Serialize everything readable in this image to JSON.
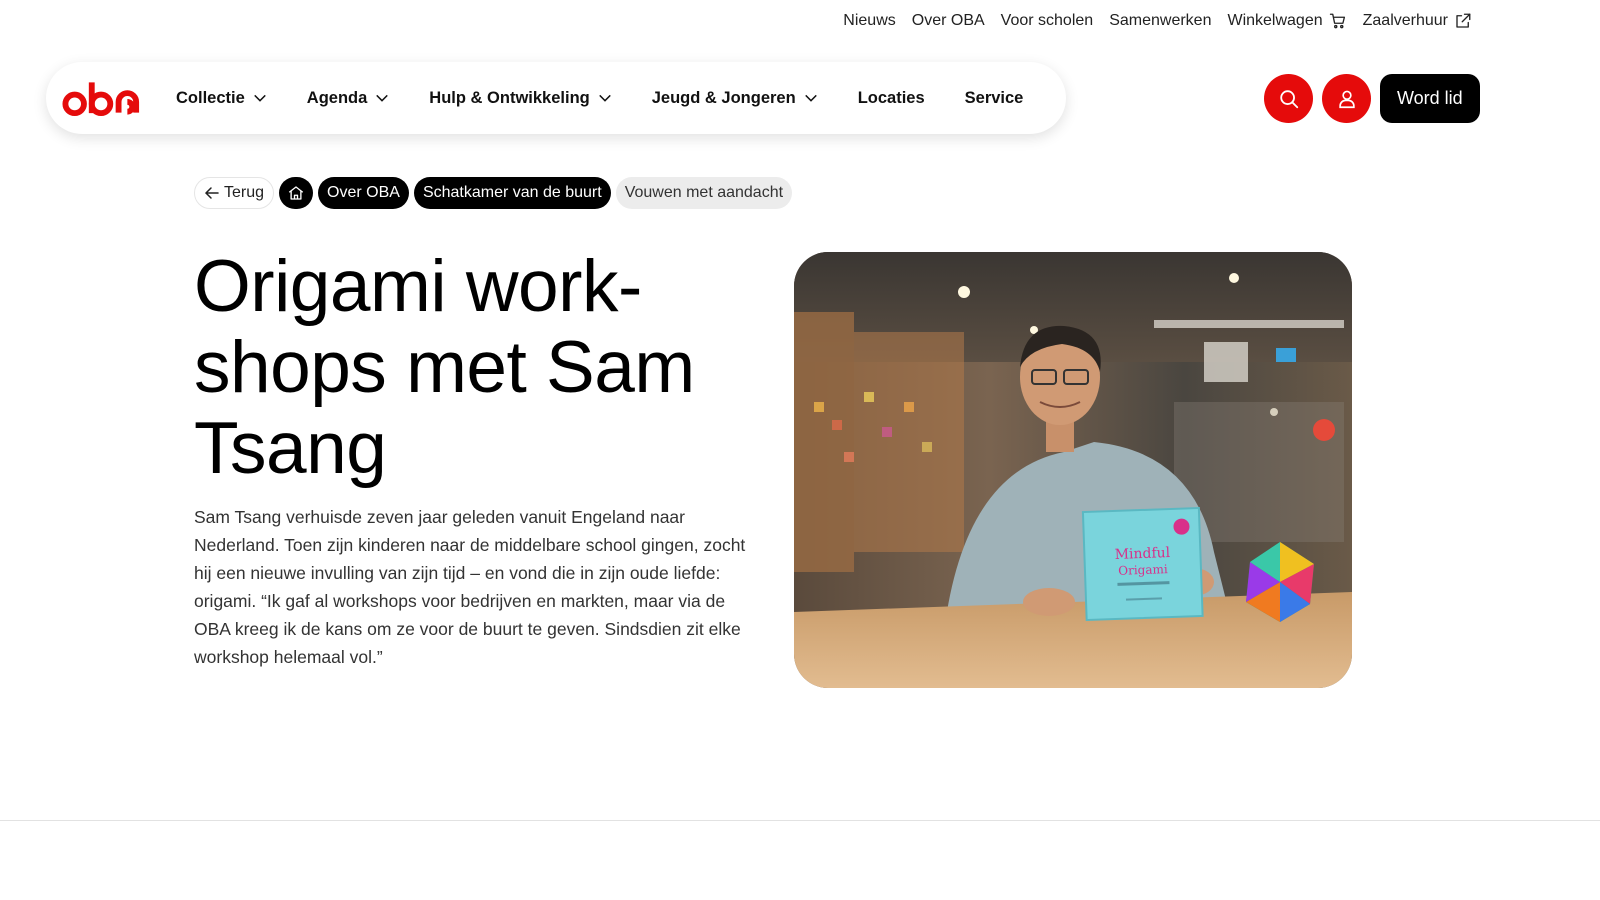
{
  "utility_nav": {
    "items": [
      {
        "label": "Nieuws"
      },
      {
        "label": "Over OBA"
      },
      {
        "label": "Voor scholen"
      },
      {
        "label": "Samenwerken"
      },
      {
        "label": "Winkelwagen",
        "icon": "cart-icon"
      },
      {
        "label": "Zaalverhuur",
        "icon": "external-link-icon"
      }
    ]
  },
  "brand": {
    "logo_text": "oba",
    "color": "#e50b0b"
  },
  "main_nav": {
    "items": [
      {
        "label": "Collectie",
        "has_dropdown": true
      },
      {
        "label": "Agenda",
        "has_dropdown": true
      },
      {
        "label": "Hulp & Ontwikkeling",
        "has_dropdown": true
      },
      {
        "label": "Jeugd & Jongeren",
        "has_dropdown": true
      },
      {
        "label": "Locaties",
        "has_dropdown": false
      },
      {
        "label": "Service",
        "has_dropdown": false
      }
    ]
  },
  "actions": {
    "search_icon": "search-icon",
    "account_icon": "user-icon",
    "join_label": "Word lid"
  },
  "breadcrumb": {
    "back_label": "Terug",
    "home_icon": "home-icon",
    "items": [
      {
        "label": "Over OBA"
      },
      {
        "label": "Schatkamer van de buurt"
      },
      {
        "label": "Vouwen met aandacht"
      }
    ]
  },
  "article": {
    "title": "Origami work-shops met Sam Tsang",
    "title_lines": [
      "Origami work-",
      "shops met Sam",
      "Tsang"
    ],
    "intro": "Sam Tsang verhuisde zeven jaar geleden vanuit Engeland naar Nederland. Toen zijn kinderen naar de middelbare school gingen, zocht hij een nieuwe invulling van zijn tijd – en vond die in zijn oude liefde: origami. “Ik gaf al workshops voor bedrijven en markten, maar via de OBA kreeg ik de kans om ze voor de buurt te geven. Sindsdien zit elke workshop helemaal vol.”",
    "photo": {
      "book_title": "Mindful Origami"
    }
  }
}
